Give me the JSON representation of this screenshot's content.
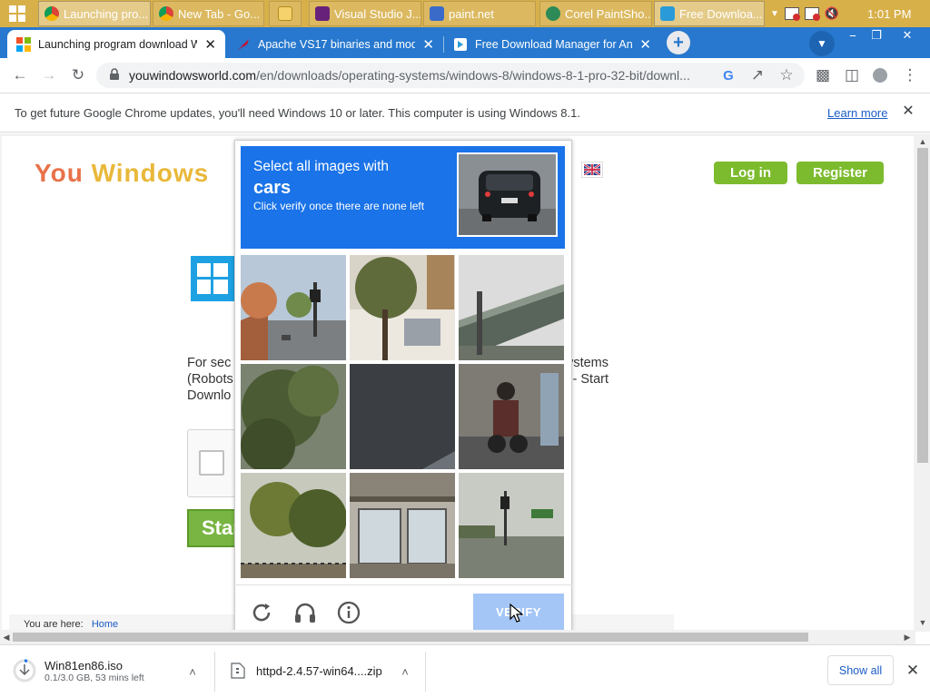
{
  "taskbar": {
    "items": [
      {
        "label": "Launching pro...",
        "icon": "chrome-icon"
      },
      {
        "label": "New Tab - Go...",
        "icon": "chrome-icon"
      },
      {
        "label": "",
        "icon": "folder-icon"
      },
      {
        "label": "Visual Studio J...",
        "icon": "visual-studio-icon"
      },
      {
        "label": "paint.net",
        "icon": "paintnet-icon"
      },
      {
        "label": "Corel PaintSho...",
        "icon": "corel-paintshop-icon"
      },
      {
        "label": "Free Downloa...",
        "icon": "free-download-manager-icon"
      }
    ],
    "clock": "1:01 PM"
  },
  "tabs": [
    {
      "label": "Launching program download W",
      "icon": "windows-flag-icon",
      "active": true
    },
    {
      "label": "Apache VS17 binaries and modul",
      "icon": "apache-feather-icon",
      "active": false
    },
    {
      "label": "Free Download Manager for And",
      "icon": "free-download-manager-icon",
      "active": false
    }
  ],
  "address_bar": {
    "host": "youwindowsworld.com",
    "path": "/en/downloads/operating-systems/windows-8/windows-8-1-pro-32-bit/downl..."
  },
  "infobar": {
    "message": "To get future Google Chrome updates, you'll need Windows 10 or later. This computer is using Windows 8.1.",
    "link": "Learn more"
  },
  "site": {
    "logo_part1": "You",
    "logo_part2": "Windows",
    "login": "Log in",
    "register": "Register",
    "para_line1_left": "For sec",
    "para_line1_right": "ystems",
    "para_line2_left": "(Robots",
    "para_line2_right": "- Start",
    "para_line3_left": "Downlo",
    "start_label": "Star",
    "breadcrumb_prefix": "You are here:",
    "breadcrumb_home": "Home"
  },
  "captcha": {
    "line1": "Select all images with",
    "target": "cars",
    "line3": "Click verify once there are none left",
    "verify_label": "VERIFY",
    "tiles": [
      "street-with-trees-and-traffic-light",
      "building-with-tree",
      "highway-overpass",
      "palm-tree",
      "dark-pavement",
      "motorcyclist",
      "palm-trees",
      "bus-shelter-under-bridge",
      "intersection-with-traffic-light"
    ]
  },
  "downloads": [
    {
      "name": "Win81en86.iso",
      "status": "0.1/3.0 GB, 53 mins left"
    },
    {
      "name": "httpd-2.4.57-win64....zip",
      "status": ""
    }
  ],
  "download_shelf": {
    "show_all": "Show all"
  }
}
